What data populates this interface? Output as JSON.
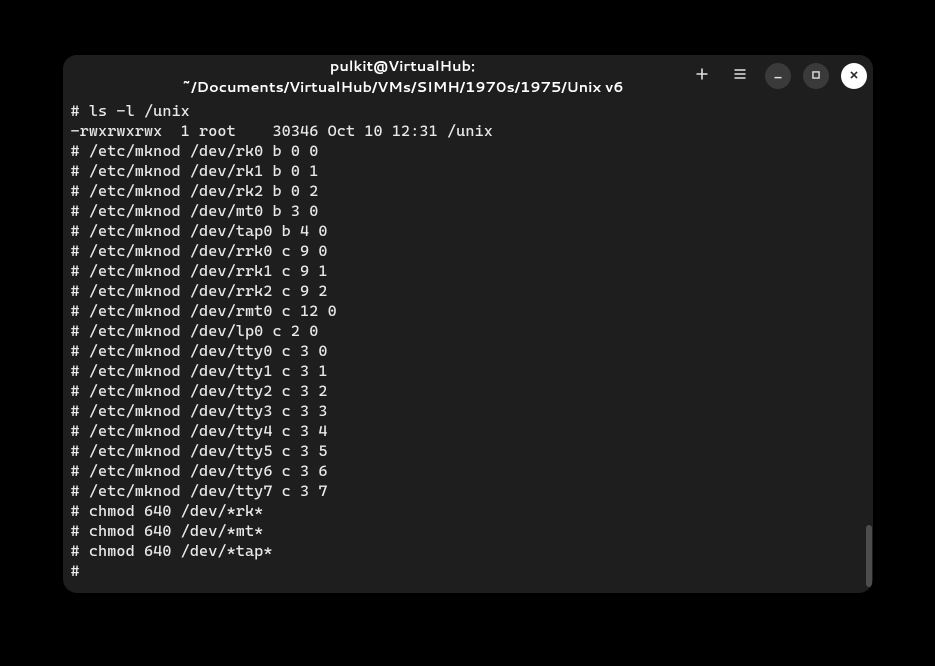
{
  "window": {
    "title": "pulkit@VirtualHub: ~/Documents/VirtualHub/VMs/SIMH/1970s/1975/Unix v6"
  },
  "terminal": {
    "lines": [
      "# ls -l /unix",
      "-rwxrwxrwx  1 root    30346 Oct 10 12:31 /unix",
      "# /etc/mknod /dev/rk0 b 0 0",
      "# /etc/mknod /dev/rk1 b 0 1",
      "# /etc/mknod /dev/rk2 b 0 2",
      "# /etc/mknod /dev/mt0 b 3 0",
      "# /etc/mknod /dev/tap0 b 4 0",
      "# /etc/mknod /dev/rrk0 c 9 0",
      "# /etc/mknod /dev/rrk1 c 9 1",
      "# /etc/mknod /dev/rrk2 c 9 2",
      "# /etc/mknod /dev/rmt0 c 12 0",
      "# /etc/mknod /dev/lp0 c 2 0",
      "# /etc/mknod /dev/tty0 c 3 0",
      "# /etc/mknod /dev/tty1 c 3 1",
      "# /etc/mknod /dev/tty2 c 3 2",
      "# /etc/mknod /dev/tty3 c 3 3",
      "# /etc/mknod /dev/tty4 c 3 4",
      "# /etc/mknod /dev/tty5 c 3 5",
      "# /etc/mknod /dev/tty6 c 3 6",
      "# /etc/mknod /dev/tty7 c 3 7",
      "# chmod 640 /dev/*rk*",
      "# chmod 640 /dev/*mt*",
      "# chmod 640 /dev/*tap*",
      "# "
    ]
  }
}
